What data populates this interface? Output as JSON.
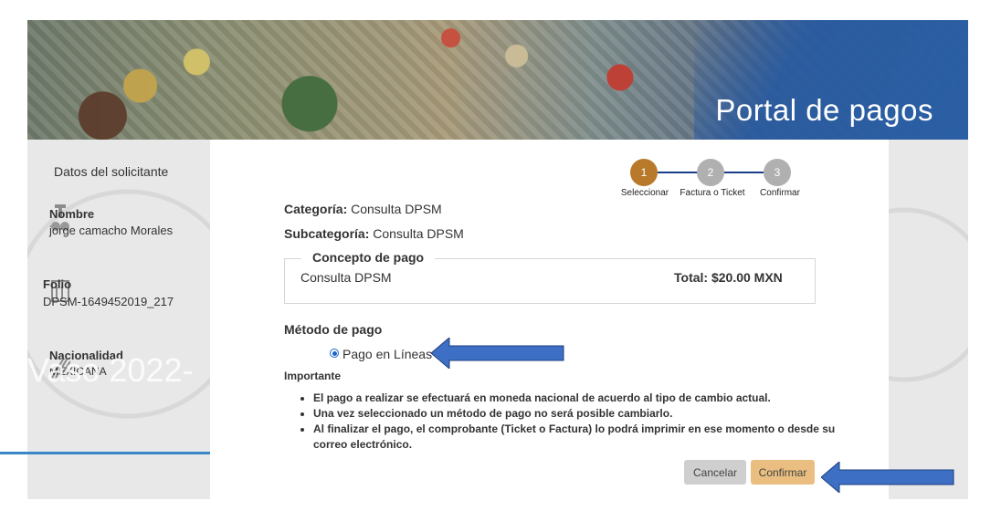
{
  "banner": {
    "title": "Portal de pagos"
  },
  "applicant": {
    "title": "Datos del solicitante",
    "fields": [
      {
        "label": "Nombre",
        "value": "jorge camacho Morales",
        "icon": "person-icon"
      },
      {
        "label": "Folio",
        "value": "DPSM-1649452019_217",
        "icon": "document-icon"
      },
      {
        "label": "Nacionalidad",
        "value": "MEXICANA",
        "icon": "flag-icon"
      }
    ]
  },
  "overlay_text": "o Vaso 2022-",
  "stepper": {
    "steps": [
      {
        "number": "1",
        "label": "Seleccionar",
        "active": true
      },
      {
        "number": "2",
        "label": "Factura o Ticket",
        "active": false
      },
      {
        "number": "3",
        "label": "Confirmar",
        "active": false
      }
    ]
  },
  "categoria": {
    "label": "Categoría:",
    "value": "Consulta DPSM"
  },
  "subcategoria": {
    "label": "Subcategoría:",
    "value": "Consulta DPSM"
  },
  "concepto": {
    "legend": "Concepto de pago",
    "name": "Consulta DPSM",
    "total": "Total: $20.00 MXN"
  },
  "metodo": {
    "title": "Método de pago",
    "option": "Pago en Líneas"
  },
  "importante": {
    "title": "Importante",
    "bullets": [
      "El pago a realizar se efectuará en moneda nacional de acuerdo al tipo de cambio actual.",
      "Una vez seleccionado un método de pago no será posible cambiarlo.",
      "Al finalizar el pago, el comprobante (Ticket o Factura) lo podrá imprimir en ese momento o desde su correo electrónico."
    ]
  },
  "buttons": {
    "cancel": "Cancelar",
    "confirm": "Confirmar"
  },
  "colors": {
    "step_active": "#b8792a",
    "step_inactive": "#b0b0b0",
    "step_line": "#1a3d8a",
    "arrow_fill": "#3d6fc4",
    "confirm_bg": "#e9be80",
    "cancel_bg": "#cfcfcf"
  }
}
